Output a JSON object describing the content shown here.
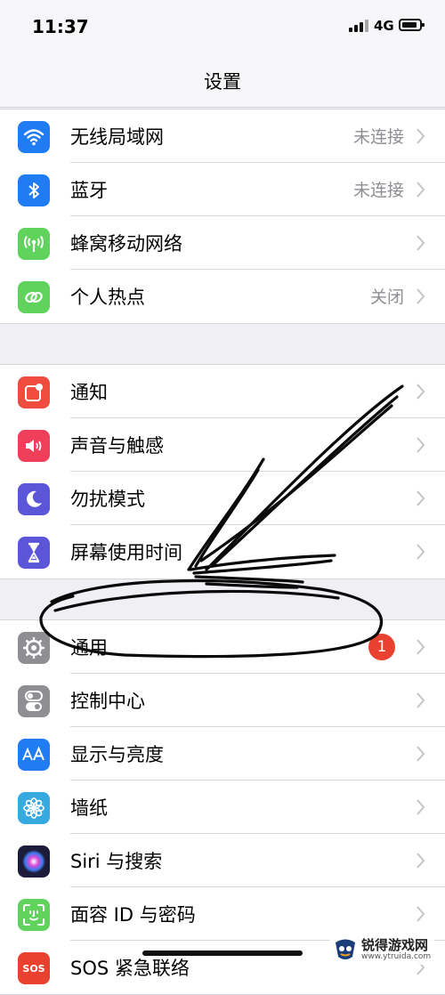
{
  "status": {
    "time": "11:37",
    "network": "4G"
  },
  "nav": {
    "title": "设置"
  },
  "groups": [
    [
      {
        "label": "无线局域网",
        "value": "未连接",
        "icon": "wifi-icon",
        "color": "#1f7cf2"
      },
      {
        "label": "蓝牙",
        "value": "未连接",
        "icon": "bluetooth-icon",
        "color": "#1f7cf2"
      },
      {
        "label": "蜂窝移动网络",
        "value": "",
        "icon": "cellular-antenna-icon",
        "color": "#5fd35b"
      },
      {
        "label": "个人热点",
        "value": "关闭",
        "icon": "hotspot-link-icon",
        "color": "#5fd35b"
      }
    ],
    [
      {
        "label": "通知",
        "value": "",
        "icon": "notification-icon",
        "color": "#f04b3f"
      },
      {
        "label": "声音与触感",
        "value": "",
        "icon": "speaker-icon",
        "color": "#ef3f5a"
      },
      {
        "label": "勿扰模式",
        "value": "",
        "icon": "moon-icon",
        "color": "#5b55d8"
      },
      {
        "label": "屏幕使用时间",
        "value": "",
        "icon": "hourglass-icon",
        "color": "#5b55d8"
      }
    ],
    [
      {
        "label": "通用",
        "value": "",
        "badge": "1",
        "icon": "gear-icon",
        "color": "#8e8e93"
      },
      {
        "label": "控制中心",
        "value": "",
        "icon": "toggle-switches-icon",
        "color": "#8e8e93"
      },
      {
        "label": "显示与亮度",
        "value": "",
        "icon": "text-size-icon",
        "color": "#1f7cf2"
      },
      {
        "label": "墙纸",
        "value": "",
        "icon": "flower-icon",
        "color": "#35a9e0"
      },
      {
        "label": "Siri 与搜索",
        "value": "",
        "icon": "siri-icon",
        "color": "#1c1c3a"
      },
      {
        "label": "面容 ID 与密码",
        "value": "",
        "icon": "face-id-icon",
        "color": "#5fd35b"
      },
      {
        "label": "SOS 紧急联络",
        "value": "",
        "icon": "sos-icon",
        "color": "#e9412f"
      }
    ]
  ],
  "watermark": {
    "name": "锐得游戏网",
    "url": "www.ytruida.com"
  }
}
